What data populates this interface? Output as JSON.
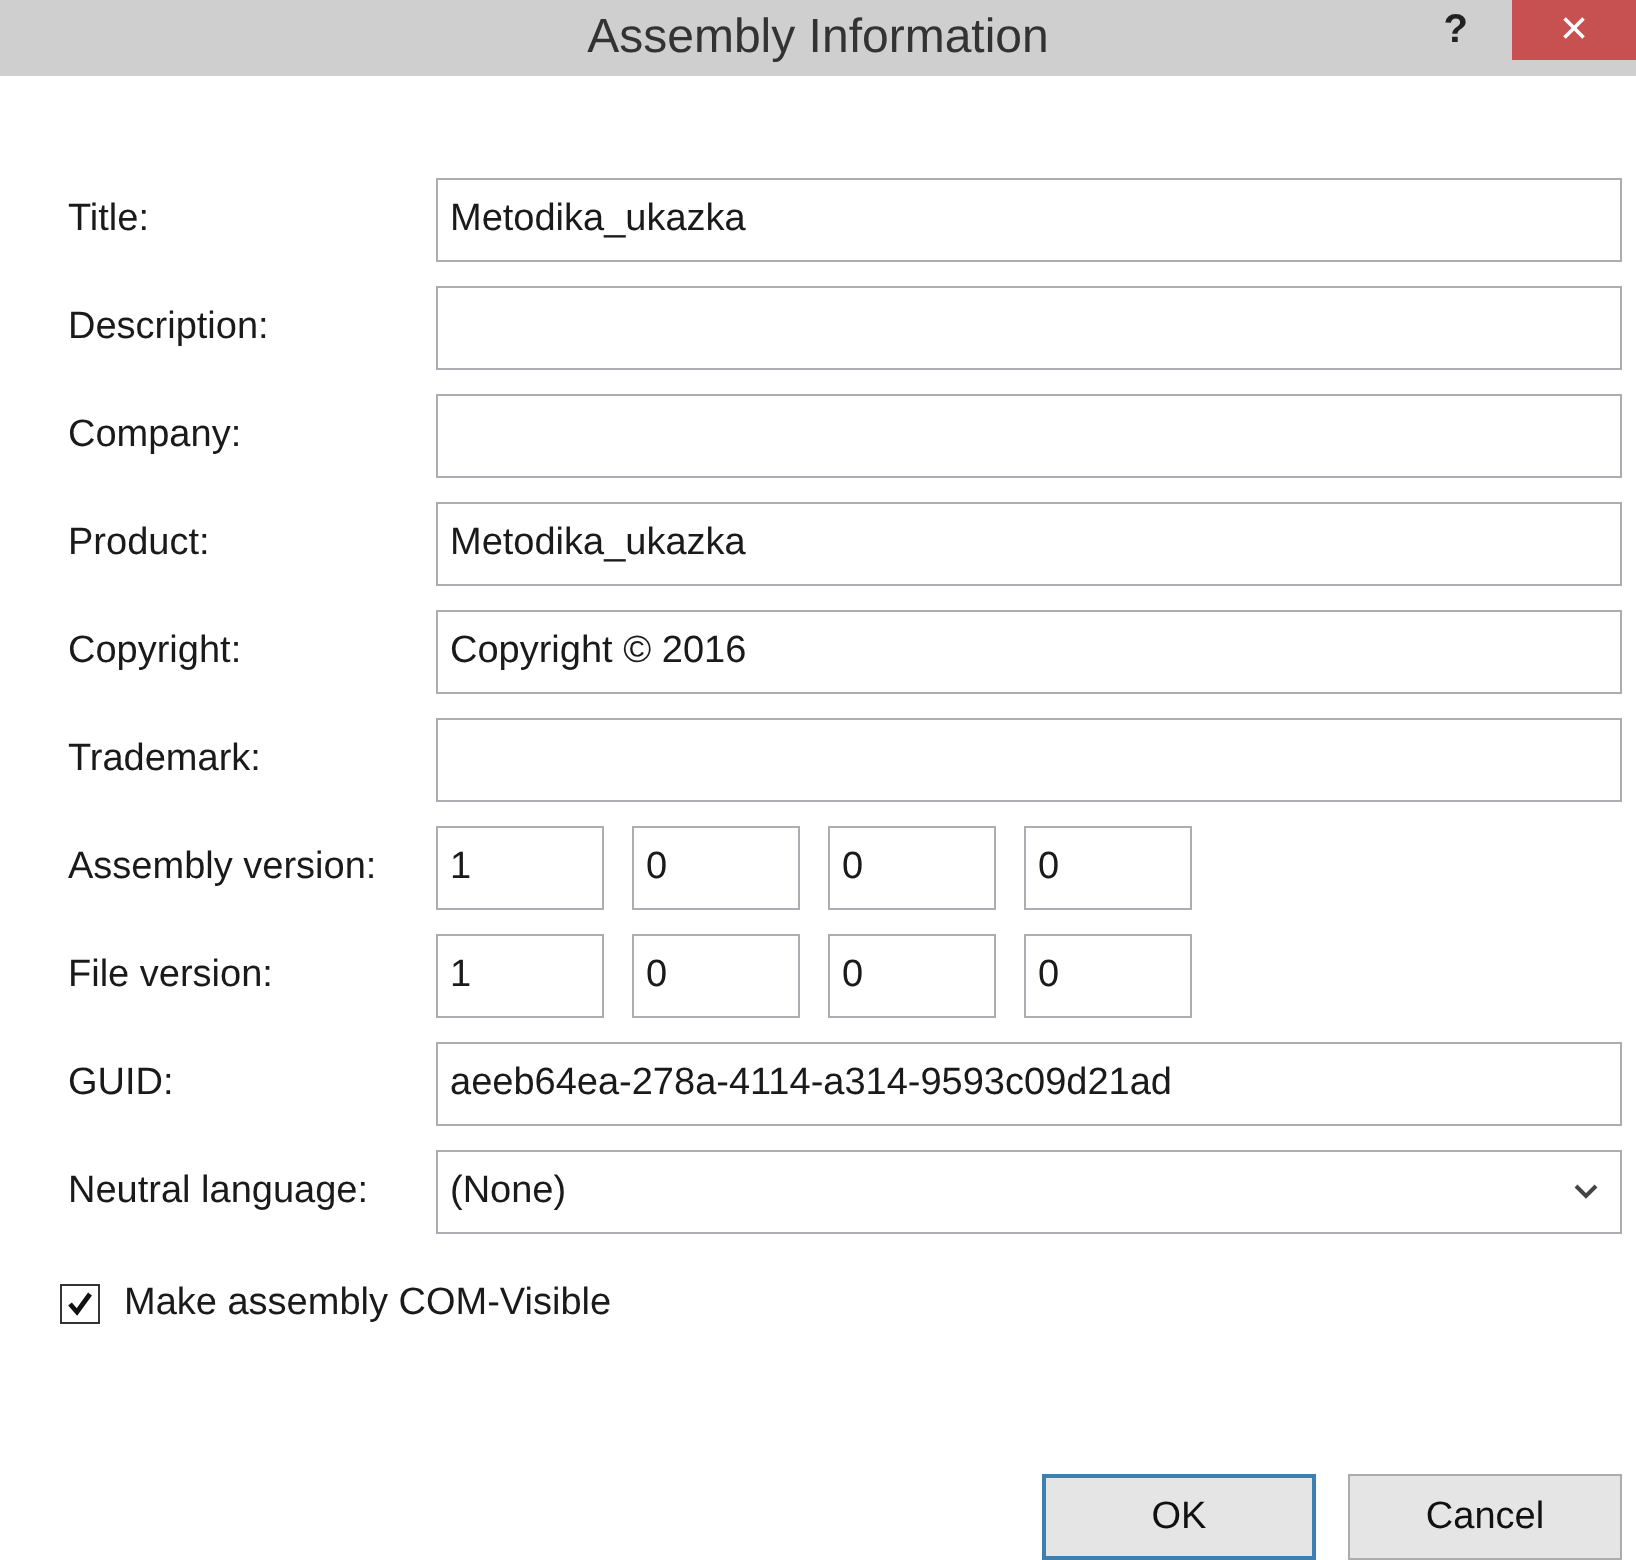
{
  "window": {
    "title": "Assembly Information",
    "help": "?",
    "close": "×"
  },
  "fields": [
    {
      "label": "Title:",
      "kind": "text",
      "value": "Metodika_ukazka"
    },
    {
      "label": "Description:",
      "kind": "text"
    },
    {
      "label": "Company:",
      "kind": "text"
    },
    {
      "label": "Product:",
      "kind": "text",
      "value": "Metodika_ukazka"
    },
    {
      "label": "Copyright:",
      "kind": "text",
      "value": "Copyright ©  2016"
    },
    {
      "label": "Trademark:",
      "kind": "text"
    },
    {
      "label": "Assembly version:",
      "kind": "version",
      "parts": [
        "1",
        "0",
        "0",
        "0"
      ]
    },
    {
      "label": "File version:",
      "kind": "version",
      "parts": [
        "1",
        "0",
        "0",
        "0"
      ]
    },
    {
      "label": "GUID:",
      "kind": "text",
      "value": "aeeb64ea-278a-4114-a314-9593c09d21ad"
    },
    {
      "label": "Neutral language:",
      "kind": "dropdown",
      "value": "(None)"
    }
  ],
  "com_visible": {
    "label": "Make assembly COM-Visible",
    "checked": true
  },
  "buttons": [
    {
      "label": "OK",
      "default": true
    },
    {
      "label": "Cancel",
      "default": false
    }
  ]
}
